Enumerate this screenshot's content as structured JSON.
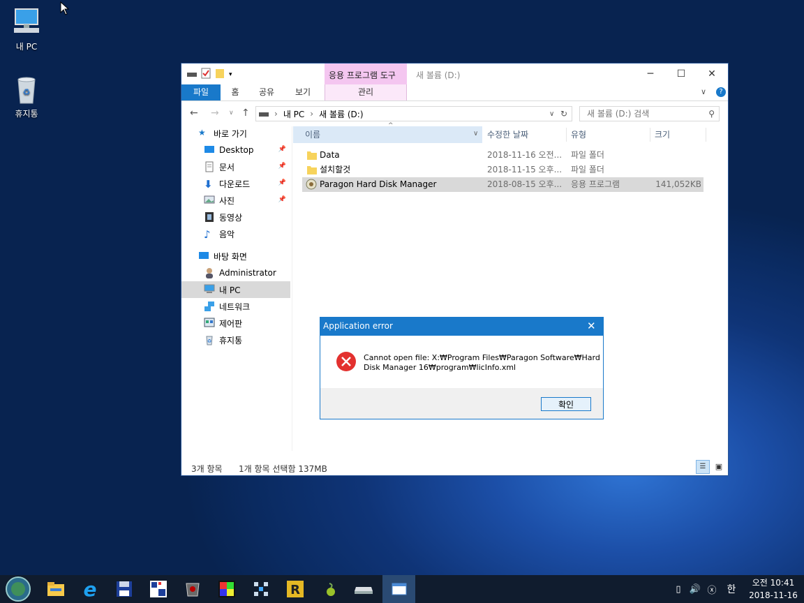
{
  "desktop": {
    "icons": [
      {
        "label": "내 PC",
        "icon": "computer-icon"
      },
      {
        "label": "휴지통",
        "icon": "recycle-bin-icon"
      }
    ]
  },
  "explorer": {
    "title": "새 볼륨 (D:)",
    "context_tab_header": "응용 프로그램 도구",
    "ribbon_tabs": [
      "파일",
      "홈",
      "공유",
      "보기",
      "관리"
    ],
    "address": {
      "segments": [
        "내 PC",
        "새 볼륨 (D:)"
      ]
    },
    "search_placeholder": "새 볼륨 (D:) 검색",
    "nav": {
      "quick_access": "바로 가기",
      "items": [
        {
          "label": "Desktop",
          "pinned": true,
          "icon": "desktop-icon"
        },
        {
          "label": "문서",
          "pinned": true,
          "icon": "documents-icon"
        },
        {
          "label": "다운로드",
          "pinned": true,
          "icon": "download-icon"
        },
        {
          "label": "사진",
          "pinned": true,
          "icon": "pictures-icon"
        },
        {
          "label": "동영상",
          "pinned": false,
          "icon": "videos-icon"
        },
        {
          "label": "음악",
          "pinned": false,
          "icon": "music-icon"
        }
      ],
      "desktop_root": "바탕 화면",
      "root_items": [
        {
          "label": "Administrator",
          "icon": "user-icon"
        },
        {
          "label": "내 PC",
          "icon": "computer-icon",
          "selected": true
        },
        {
          "label": "네트워크",
          "icon": "network-icon"
        },
        {
          "label": "제어판",
          "icon": "control-panel-icon"
        },
        {
          "label": "휴지통",
          "icon": "recycle-bin-icon"
        }
      ]
    },
    "columns": [
      "이름",
      "수정한 날짜",
      "유형",
      "크기"
    ],
    "files": [
      {
        "name": "Data",
        "date": "2018-11-16 오전...",
        "type": "파일 폴더",
        "size": "",
        "icon": "folder-icon"
      },
      {
        "name": "설치할것",
        "date": "2018-11-15 오후...",
        "type": "파일 폴더",
        "size": "",
        "icon": "folder-icon"
      },
      {
        "name": "Paragon Hard Disk Manager",
        "date": "2018-08-15 오후...",
        "type": "응용 프로그램",
        "size": "141,052KB",
        "icon": "app-icon",
        "selected": true
      }
    ],
    "status": {
      "count": "3개 항목",
      "selection": "1개 항목 선택함 137MB"
    }
  },
  "dialog": {
    "title": "Application error",
    "message_line1": "Cannot open file: X:₩Program Files₩Paragon Software₩Hard",
    "message_line2": "Disk Manager 16₩program₩licInfo.xml",
    "ok_label": "확인"
  },
  "taskbar": {
    "apps": [
      "start-orb-icon",
      "file-explorer-icon",
      "internet-explorer-icon",
      "save-disk-icon",
      "grid-app-icon",
      "game-app-icon",
      "color-app-icon",
      "network-app-icon",
      "r-app-icon",
      "olive-app-icon",
      "drive-icon",
      "window-app-icon"
    ],
    "ime": "한",
    "time": "오전 10:41",
    "date": "2018-11-16"
  }
}
